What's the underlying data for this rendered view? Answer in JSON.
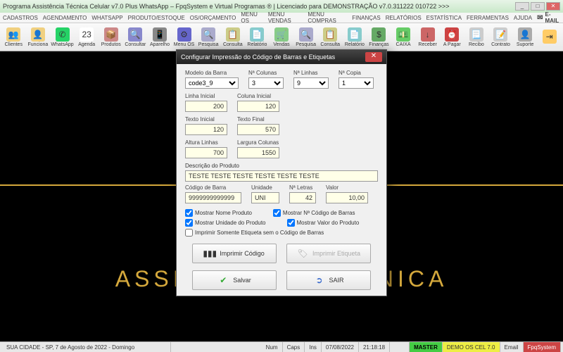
{
  "window": {
    "title": "Programa Assistência Técnica Celular v7.0 Plus WhatsApp – FpqSystem e Virtual Programas ® | Licenciado para  DEMONSTRAÇÃO v7.0.311222 010722 >>>"
  },
  "menubar": {
    "items": [
      "CADASTROS",
      "AGENDAMENTO",
      "WHATSAPP",
      "PRODUTO/ESTOQUE",
      "OS/ORÇAMENTO",
      "MENU OS",
      "MENU VENDAS",
      "MENU COMPRAS",
      "FINANÇAS",
      "RELATÓRIOS",
      "ESTATÍSTICA",
      "FERRAMENTAS",
      "AJUDA"
    ],
    "email": "E-MAIL"
  },
  "toolbar": {
    "items": [
      {
        "label": "Clientes",
        "icon": "👥",
        "bg": "#f0d080"
      },
      {
        "label": "Funciona",
        "icon": "👤",
        "bg": "#f0d080"
      },
      {
        "label": "WhatsApp",
        "icon": "✆",
        "bg": "#25d366"
      },
      {
        "label": "Agenda",
        "icon": "23",
        "bg": "#fff"
      },
      {
        "label": "Produtos",
        "icon": "📦",
        "bg": "#c88"
      },
      {
        "label": "Consultar",
        "icon": "🔍",
        "bg": "#88c"
      },
      {
        "label": "Aparelho",
        "icon": "📱",
        "bg": "#888"
      },
      {
        "label": "Menu OS",
        "icon": "⚙",
        "bg": "#66c"
      },
      {
        "label": "Pesquisa",
        "icon": "🔍",
        "bg": "#aac"
      },
      {
        "label": "Consulta",
        "icon": "📋",
        "bg": "#cc8"
      },
      {
        "label": "Relatório",
        "icon": "📄",
        "bg": "#8cc"
      },
      {
        "label": "Vendas",
        "icon": "🛒",
        "bg": "#8c8"
      },
      {
        "label": "Pesquisa",
        "icon": "🔍",
        "bg": "#aac"
      },
      {
        "label": "Consulta",
        "icon": "📋",
        "bg": "#cc8"
      },
      {
        "label": "Relatório",
        "icon": "📄",
        "bg": "#8cc"
      },
      {
        "label": "Finanças",
        "icon": "$",
        "bg": "#6a6"
      },
      {
        "label": "CAIXA",
        "icon": "💵",
        "bg": "#6c6"
      },
      {
        "label": "Receber",
        "icon": "↓",
        "bg": "#c66"
      },
      {
        "label": "A Pagar",
        "icon": "⏰",
        "bg": "#c44"
      },
      {
        "label": "Recibo",
        "icon": "📃",
        "bg": "#ccc"
      },
      {
        "label": "Contrato",
        "icon": "📝",
        "bg": "#ccc"
      },
      {
        "label": "Suporte",
        "icon": "👤",
        "bg": "#aaa"
      },
      {
        "label": "",
        "icon": "⇥",
        "bg": "#fc6"
      }
    ]
  },
  "brand": {
    "text": "ASSISTÊNCIA TÉCNICA"
  },
  "dialog": {
    "title": "Configurar Impressão do Código de Barras e Etiquetas",
    "modelo_label": "Modelo da Barra",
    "modelo_value": "code3_9",
    "ncolunas_label": "Nª Colunas",
    "ncolunas_value": "3",
    "nlinhas_label": "Nª Linhas",
    "nlinhas_value": "9",
    "ncopia_label": "Nª Copia",
    "ncopia_value": "1",
    "linha_inicial_label": "Linha Inicial",
    "linha_inicial": "200",
    "coluna_inicial_label": "Coluna Inicial",
    "coluna_inicial": "120",
    "texto_inicial_label": "Texto Inicial",
    "texto_inicial": "120",
    "texto_final_label": "Texto Final",
    "texto_final": "570",
    "altura_linhas_label": "Altura Linhas",
    "altura_linhas": "700",
    "largura_colunas_label": "Largura Colunas",
    "largura_colunas": "1550",
    "descricao_label": "Descrição do Produto",
    "descricao": "TESTE TESTE TESTE TESTE TESTE TESTE",
    "codigo_barra_label": "Código de Barra",
    "codigo_barra": "9999999999999",
    "unidade_label": "Unidade",
    "unidade": "UNI",
    "nletras_label": "Nª Letras",
    "nletras": "42",
    "valor_label": "Valor",
    "valor": "10,00",
    "chk_nome": "Mostrar Nome Produto",
    "chk_codigo": "Mostrar Nª Código de Barras",
    "chk_unidade": "Mostrar Unidade do Produto",
    "chk_valor": "Mostrar Valor do Produto",
    "chk_somente": "Imprimir Somente Etiqueta sem o Código de Barras",
    "btn_imprimir_codigo": "Imprimir Código",
    "btn_imprimir_etiqueta": "Imprimir Etiqueta",
    "btn_salvar": "Salvar",
    "btn_sair": "SAIR"
  },
  "statusbar": {
    "location": "SUA CIDADE - SP, 7 de Agosto de 2022 - Domingo",
    "num": "Num",
    "caps": "Caps",
    "ins": "Ins",
    "date": "07/08/2022",
    "time": "21:18:18",
    "master": "MASTER",
    "demo": "DEMO OS CEL 7.0",
    "email": "Email",
    "brand": "FpqSystem"
  }
}
